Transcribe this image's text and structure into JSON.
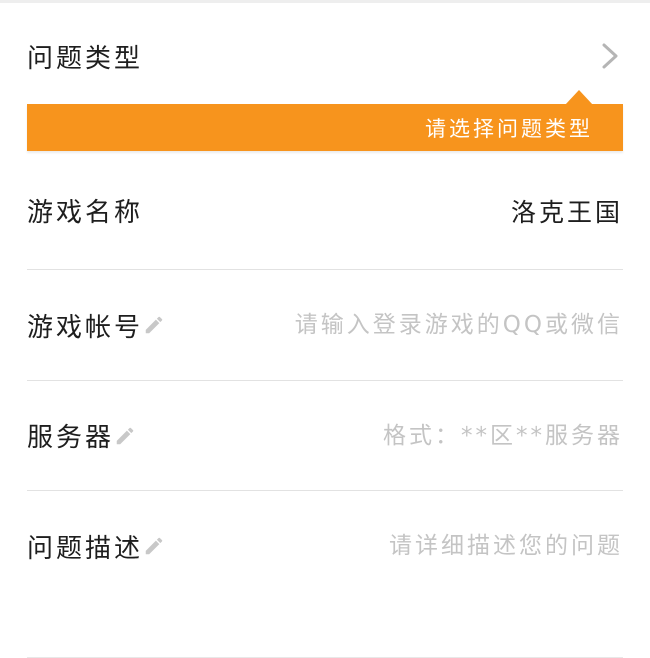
{
  "form": {
    "problem_type": {
      "label": "问题类型"
    },
    "tooltip": {
      "text": "请选择问题类型",
      "color": "#f7941d"
    },
    "game_name": {
      "label": "游戏名称",
      "value": "洛克王国"
    },
    "game_account": {
      "label": "游戏帐号",
      "placeholder": "请输入登录游戏的QQ或微信"
    },
    "server": {
      "label": "服务器",
      "placeholder": "格式：**区**服务器"
    },
    "description": {
      "label": "问题描述",
      "placeholder": "请详细描述您的问题"
    }
  },
  "icons": {
    "chevron": "chevron-right-icon",
    "pencil": "pencil-icon"
  }
}
